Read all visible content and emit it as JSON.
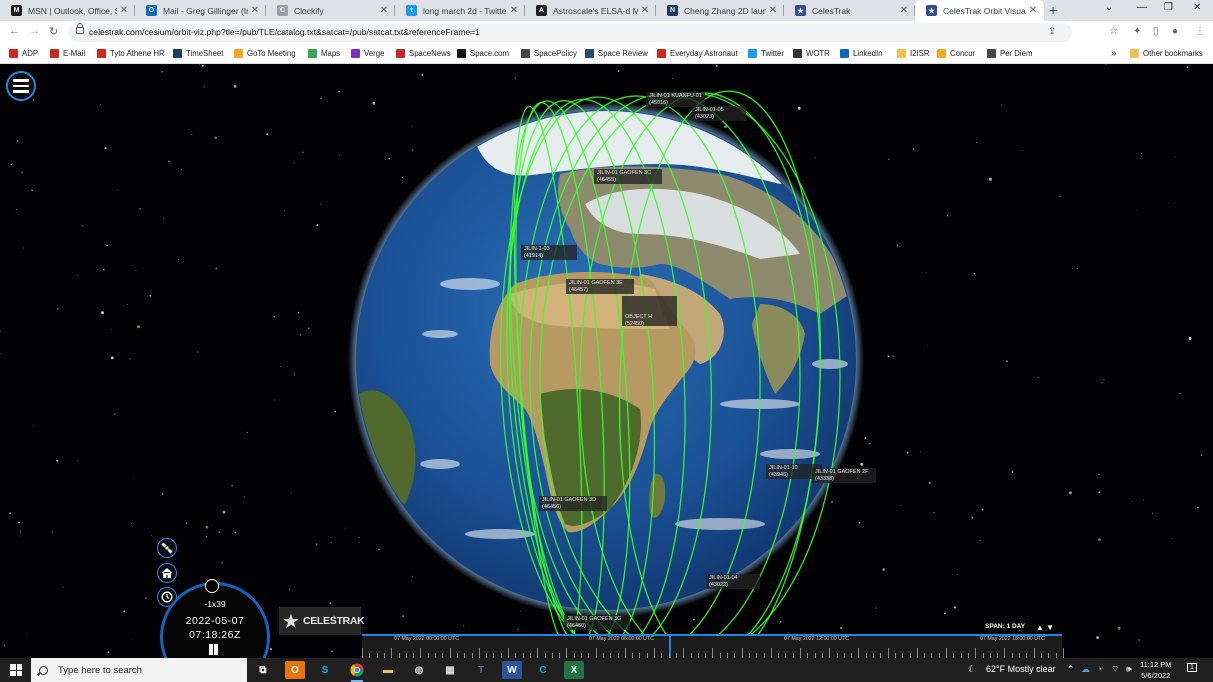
{
  "tabs": [
    {
      "title": "MSN | Outlook, Office, Skype",
      "icon": "msn-icon",
      "color": "#1a1a1a",
      "glyph": "M"
    },
    {
      "title": "Mail - Greg Gillinger (Integ",
      "icon": "outlook-mail-icon",
      "color": "#0f6cbd",
      "glyph": "O"
    },
    {
      "title": "Clockify",
      "icon": "clockify-icon",
      "color": "#9aa0a6",
      "glyph": "C"
    },
    {
      "title": "long march 2d - Twitter Se",
      "icon": "twitter-icon",
      "color": "#1d9bf0",
      "glyph": "t"
    },
    {
      "title": "Astroscale's ELSA-d Missi",
      "icon": "astroscale-icon",
      "color": "#222222",
      "glyph": "A"
    },
    {
      "title": "Cheng Zhang 2D launcher",
      "icon": "news-n-icon",
      "color": "#1f3a68",
      "glyph": "N"
    },
    {
      "title": "CelesTrak",
      "icon": "celestrak-star-icon",
      "color": "#2f4f8f",
      "glyph": "★"
    },
    {
      "title": "CelesTrak Orbit Visualizatio",
      "icon": "celestrak-star-icon",
      "color": "#2f4f8f",
      "glyph": "★"
    }
  ],
  "address": {
    "url": "celestrak.com/cesium/orbit-viz.php?tle=/pub/TLE/catalog.txt&satcat=/pub/satcat.txt&referenceFrame=1"
  },
  "bookmarks": [
    {
      "label": "ADP",
      "color": "#d0271d"
    },
    {
      "label": "E-Mail",
      "color": "#d0271d"
    },
    {
      "label": "Tyto Athene HR",
      "color": "#d0271d"
    },
    {
      "label": "TimeSheet",
      "color": "#1f3a68"
    },
    {
      "label": "GoTo Meeting",
      "color": "#f5a623"
    },
    {
      "label": "Maps",
      "color": "#34a853"
    },
    {
      "label": "Verge",
      "color": "#7b2fbf"
    },
    {
      "label": "SpaceNews",
      "color": "#c62828"
    },
    {
      "label": "Space.com",
      "color": "#111111"
    },
    {
      "label": "SpacePolicy",
      "color": "#444444"
    },
    {
      "label": "Space Review",
      "color": "#2e4a6b"
    },
    {
      "label": "Everyday Astronaut",
      "color": "#d0271d"
    },
    {
      "label": "Twitter",
      "color": "#1d9bf0"
    },
    {
      "label": "WOTR",
      "color": "#333333"
    },
    {
      "label": "LinkedIn",
      "color": "#0a66c2"
    },
    {
      "label": "I2ISR",
      "color": "#f2c14e"
    },
    {
      "label": "Concur",
      "color": "#f5a623"
    },
    {
      "label": "Per Diem",
      "color": "#444444"
    }
  ],
  "bookmarks_more": "»",
  "other_bookmarks": "Other bookmarks",
  "satellites": [
    {
      "name": "JILIN-01 KUANFU-01",
      "id": "(45016)"
    },
    {
      "name": "JILIN-01-05",
      "id": "(43023)"
    },
    {
      "name": "JILIN-01 GAOFEN 3C",
      "id": "(46455)"
    },
    {
      "name": "JILIN-1-03",
      "id": "(41914)"
    },
    {
      "name": "JILIN-01 GAOFEN 3E",
      "id": "(46457)"
    },
    {
      "name": "OBJECT H",
      "id": "(52450)"
    },
    {
      "name": "JILIN-01-10",
      "id": "(43946)"
    },
    {
      "name": "JILIN-01 GAOFEN 2F",
      "id": "(43338)"
    },
    {
      "name": "JILIN-01 GAOFEN 3D",
      "id": "(46456)"
    },
    {
      "name": "JILIN-01-04",
      "id": "(43022)"
    },
    {
      "name": "JILIN-01 GAOFEN 3G",
      "id": "(46460)"
    }
  ],
  "clock": {
    "rate": "-1x39",
    "date": "2022-05-07",
    "time": "07:18:26Z"
  },
  "logo_text": "CELESTRAK",
  "timeline": {
    "span_label": "SPAN:",
    "span_value": "1 DAY",
    "labels": [
      "07 May 2022 00:00:00 UTC",
      "07 May 2022 06:00:00 UTC",
      "07 May 2022 12:00:00 UTC",
      "07 May 2022 18:00:00 UTC"
    ]
  },
  "taskbar": {
    "search_placeholder": "Type here to search",
    "weather": "62°F  Mostly clear",
    "time": "11:12 PM",
    "date": "5/6/2022",
    "notification_count": "1"
  },
  "colors": {
    "orbit": "#39ff2a",
    "accent": "#1e88e5"
  }
}
